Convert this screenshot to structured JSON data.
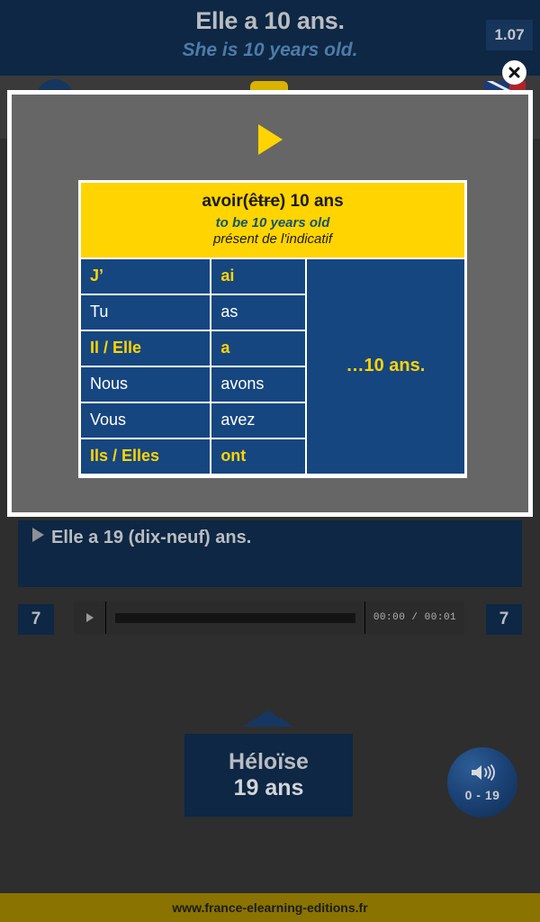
{
  "header": {
    "title": "Elle a 10 ans.",
    "subtitle": "She is 10 years old.",
    "lesson_badge": "1.07",
    "bg_color": "#0d2744"
  },
  "close_button": {
    "icon": "close-icon",
    "label": "×"
  },
  "modal": {
    "play_icon": "play-triangle-icon",
    "accent_yellow": "#ffd400",
    "accent_blue": "#164680",
    "background": "#666666",
    "conjugation": {
      "verb_main": "avoir",
      "verb_struck": "être",
      "verb_object": "10 ans",
      "paren_open": "(",
      "paren_close": ")",
      "translation": "to be 10 years old",
      "tense": "présent de l'indicatif",
      "tail": "…10 ans.",
      "rows": [
        {
          "pronoun": "J’",
          "verb": "ai",
          "highlight": true
        },
        {
          "pronoun": "Tu",
          "verb": "as",
          "highlight": false
        },
        {
          "pronoun": "Il / Elle",
          "verb": "a",
          "highlight": true
        },
        {
          "pronoun": "Nous",
          "verb": "avons",
          "highlight": false
        },
        {
          "pronoun": "Vous",
          "verb": "avez",
          "highlight": false
        },
        {
          "pronoun": "Ils / Elles",
          "verb": "ont",
          "highlight": true
        }
      ]
    }
  },
  "sentence": {
    "text": "Elle a 19 (dix-neuf) ans.",
    "play_icon": "play-triangle-icon"
  },
  "player": {
    "page_left": "7",
    "page_right": "7",
    "play_icon": "play-icon",
    "time": "00:00 / 00:01"
  },
  "lower": {
    "person_name": "Héloïse",
    "person_age": "19 ans",
    "arrow_icon": "arrow-up-icon",
    "speaker_icon": "speaker-icon",
    "speaker_range": "0 - 19"
  },
  "footer": {
    "url": "www.france-elearning-editions.fr",
    "bg_color": "#8a7300"
  }
}
